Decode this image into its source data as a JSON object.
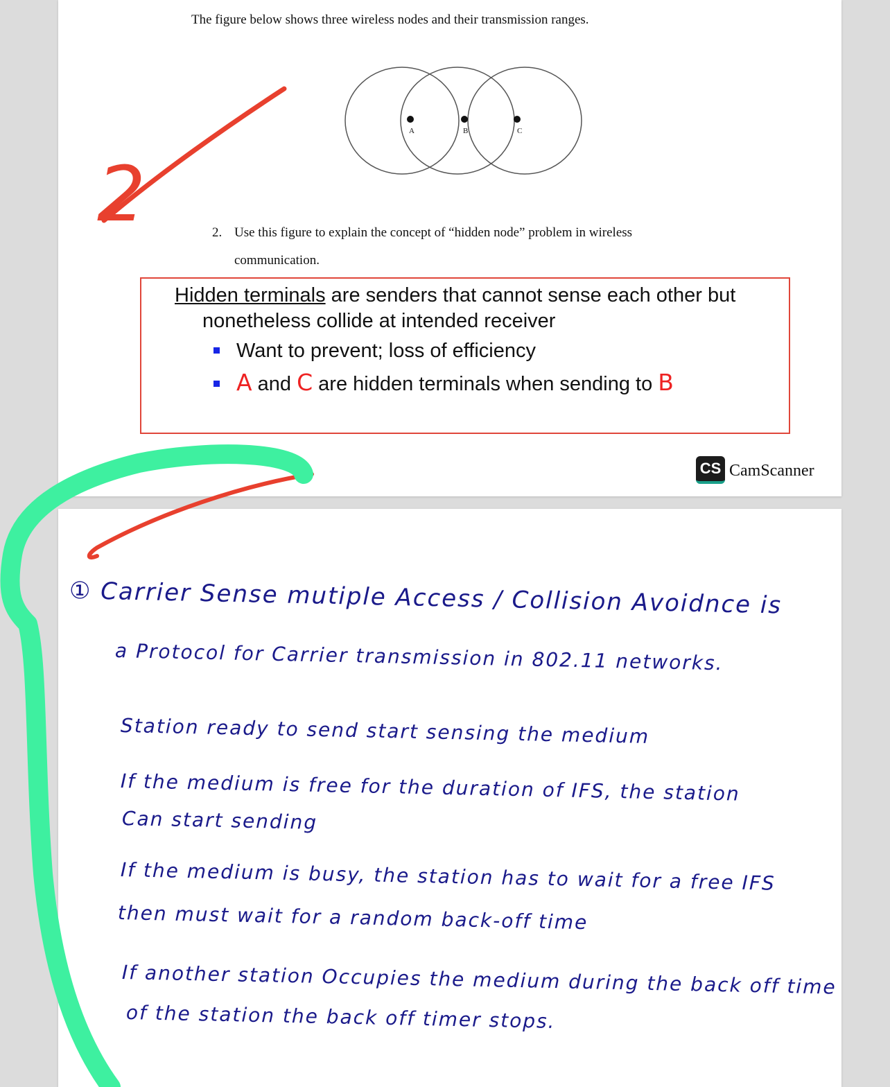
{
  "scan_page": {
    "intro_text": "The figure below shows three wireless nodes and their transmission ranges.",
    "node_labels": [
      "A",
      "B",
      "C"
    ],
    "question": {
      "number": "2.",
      "line1": "Use this figure to explain the concept of “hidden node” problem in wireless",
      "line2": "communication."
    },
    "answer_box": {
      "term": "Hidden terminals",
      "line1_rest": " are senders that cannot sense each other but",
      "line2": "nonetheless collide at intended receiver",
      "bullet1": "Want to prevent; loss of efficiency",
      "bullet2_a": "A",
      "bullet2_and": " and ",
      "bullet2_c": "C",
      "bullet2_mid": " are hidden terminals when sending to ",
      "bullet2_b": "B"
    },
    "grade_mark": "2",
    "watermark": {
      "logo": "CS",
      "text": "CamScanner"
    }
  },
  "handwritten_page": {
    "lines": [
      "① Carrier Sense mutiple Access / Collision Avoidnce is",
      "a Protocol for Carrier transmission in 802.11 networks.",
      "Station ready to send start sensing the medium",
      "If the medium is free for the duration of IFS, the station",
      "Can start sending",
      "If the medium is busy, the station has to wait for a free IFS",
      "then must wait for a random back-off time",
      "If another station Occupies the medium during the back off time",
      "of the station the back off timer stops."
    ]
  },
  "colors": {
    "highlight": "#3ef0a0",
    "check_mark": "#e8402e",
    "handwriting": "#1a1a8a",
    "bullet": "#1726e6",
    "box_border": "#e0463a"
  }
}
